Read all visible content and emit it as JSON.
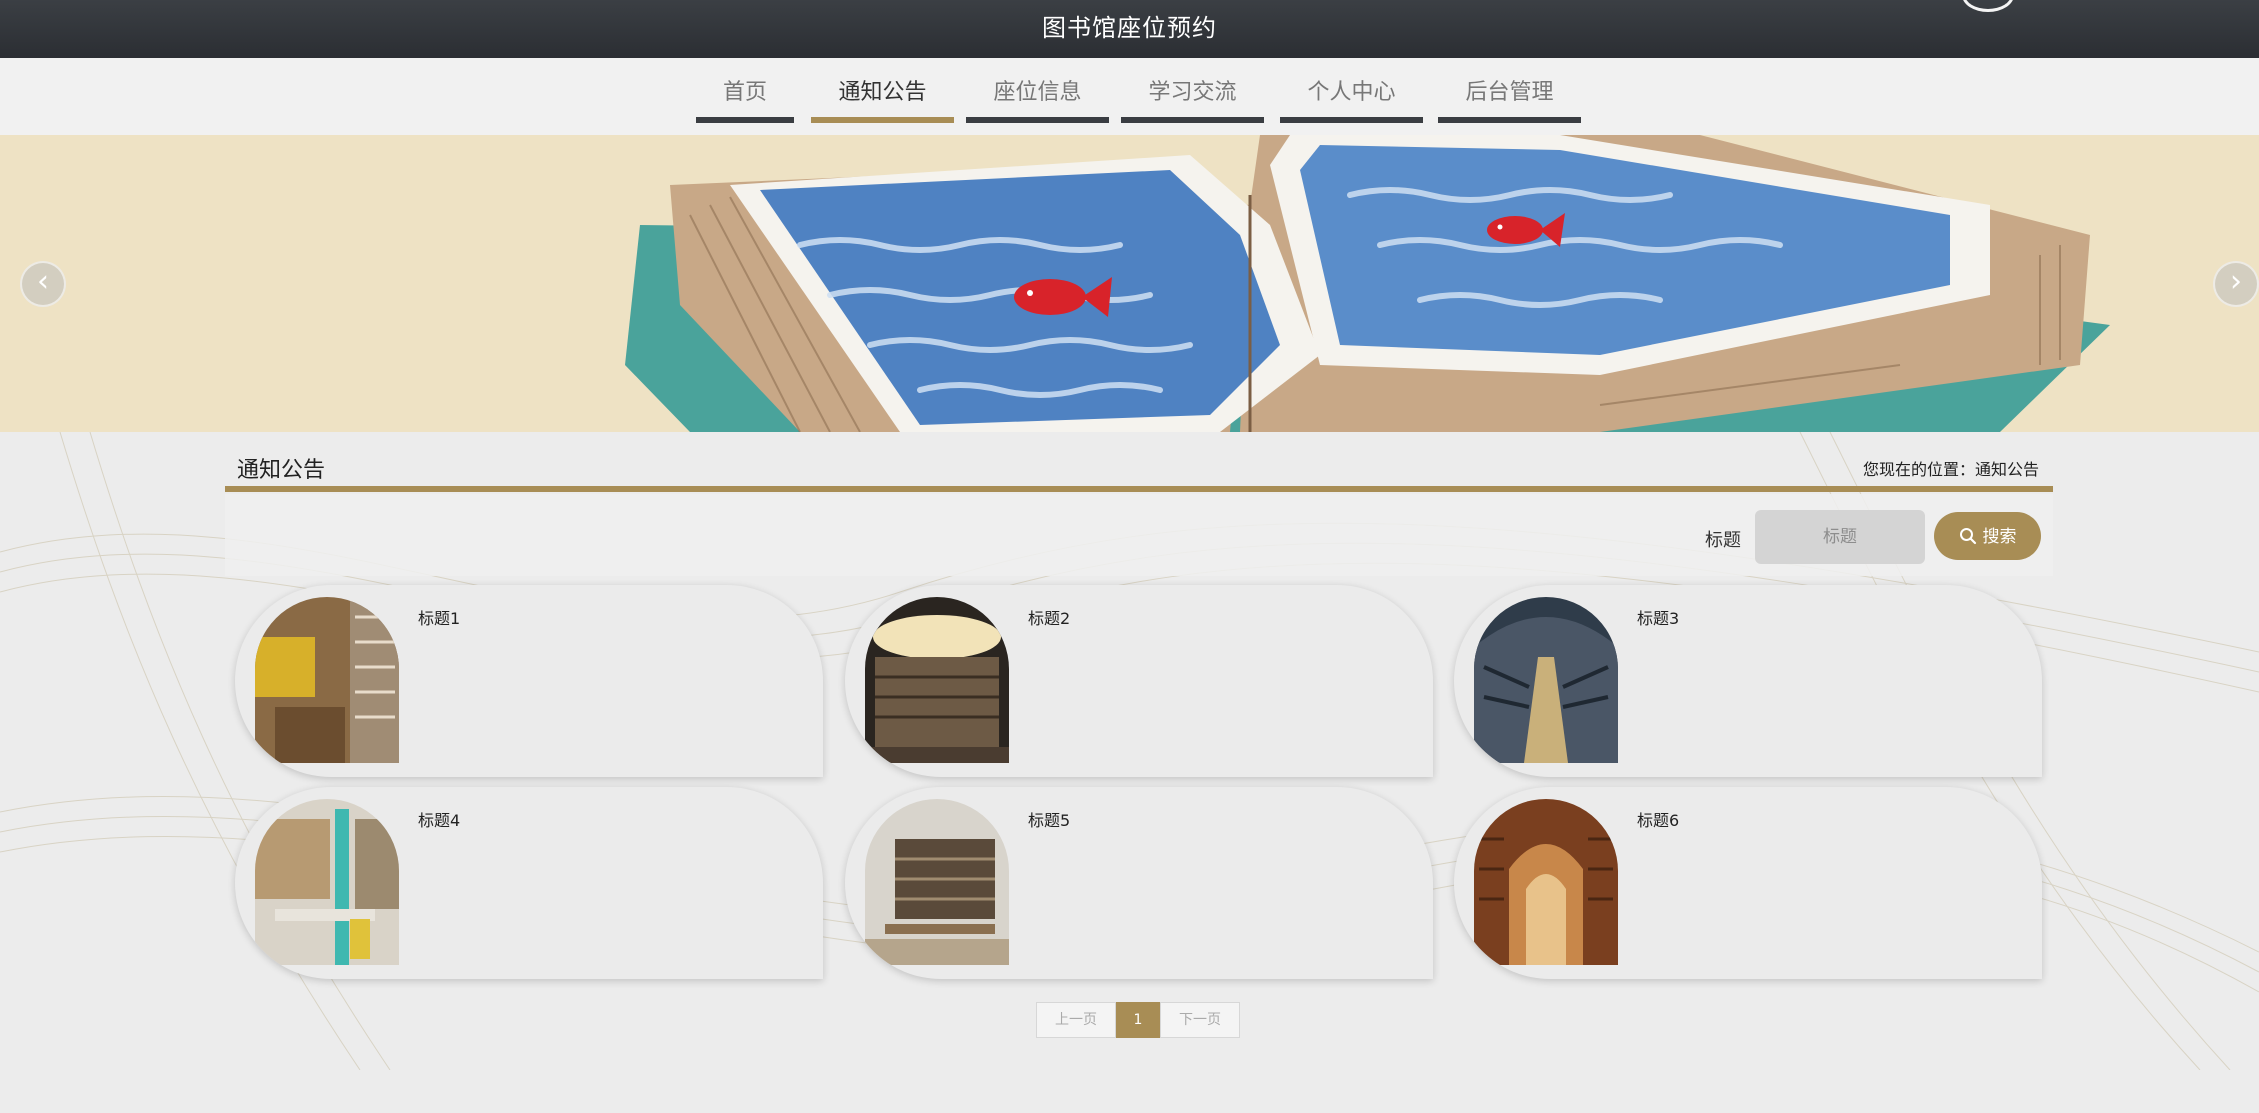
{
  "site": {
    "title": "图书馆座位预约"
  },
  "nav": {
    "items": [
      "首页",
      "通知公告",
      "座位信息",
      "学习交流",
      "个人中心",
      "后台管理"
    ],
    "active": "通知公告"
  },
  "banner": {
    "prev_label": "‹",
    "next_label": "›"
  },
  "section": {
    "title": "通知公告",
    "breadcrumb": "您现在的位置：通知公告"
  },
  "search": {
    "label": "标题",
    "placeholder": "标题",
    "button_label": "搜索"
  },
  "notices": [
    {
      "title": "标题1"
    },
    {
      "title": "标题2"
    },
    {
      "title": "标题3"
    },
    {
      "title": "标题4"
    },
    {
      "title": "标题5"
    },
    {
      "title": "标题6"
    }
  ],
  "pagination": {
    "prev": "上一页",
    "current": "1",
    "next": "下一页"
  },
  "colors": {
    "accent": "#a88d55",
    "topbar": "#2f3237",
    "nav_underline": "#3a3d42"
  }
}
